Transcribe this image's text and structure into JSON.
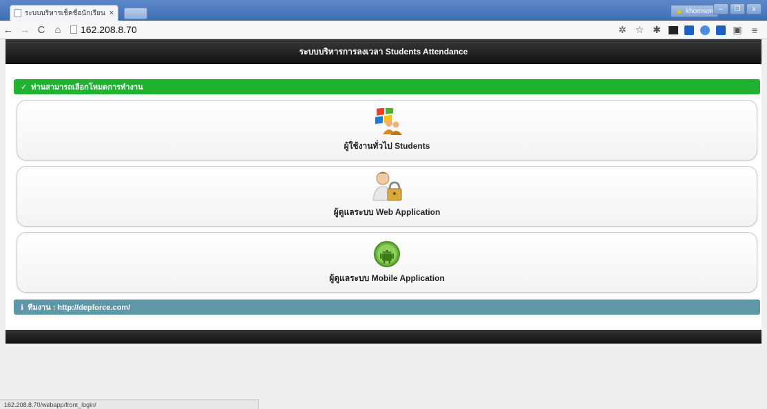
{
  "browser": {
    "tab_title": "ระบบบริหารเช็คชื่อนักเรียน Stu",
    "tab_close": "×",
    "profile_name": "khomson",
    "url": "162.208.8.70",
    "status_url": "162.208.8.70/webapp/front_login/"
  },
  "page": {
    "header_title": "ระบบบริหารการลงเวลา Students Attendance",
    "select_mode_banner": "ท่านสามารถเลือกโหมดการทำงาน",
    "cards": [
      {
        "label": "ผู้ใช้งานทั่วไป Students",
        "icon": "windows-users-icon"
      },
      {
        "label": "ผู้ดูแลระบบ Web Application",
        "icon": "user-lock-icon"
      },
      {
        "label": "ผู้ดูแลระบบ Mobile Application",
        "icon": "android-icon"
      }
    ],
    "team_banner": "ทีมงาน : http://depforce.com/"
  },
  "colors": {
    "green_banner": "#22b232",
    "info_banner": "#5d97a8",
    "header_bg": "#1a1a1a"
  }
}
